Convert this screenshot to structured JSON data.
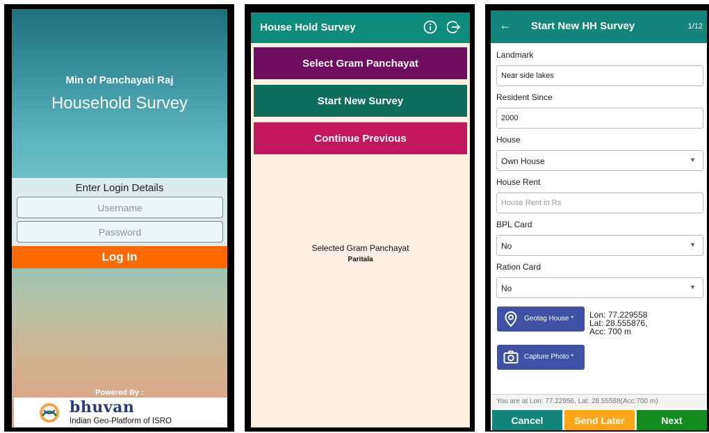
{
  "login_screen": {
    "org_name": "Min of Panchayati Raj",
    "app_name": "Household Survey",
    "login_header": "Enter Login Details",
    "username_placeholder": "Username",
    "password_placeholder": "Password",
    "login_button": "Log In",
    "powered_by": "Powered By :",
    "logo_name": "bhuvan",
    "logo_tagline": "Indian Geo-Platform of ISRO",
    "accent_color": "#ff6a00"
  },
  "home_screen": {
    "title": "House Hold Survey",
    "icons": [
      "info-icon",
      "logout-icon"
    ],
    "buttons": {
      "select_gp": "Select Gram Panchayat",
      "start_new": "Start New Survey",
      "continue_prev": "Continue Previous"
    },
    "selected_label": "Selected Gram Panchayat",
    "selected_value": "Paritala",
    "colors": {
      "header": "#0f8b7b",
      "select_gp": "#6e0d5e",
      "start_new": "#0e6e5c",
      "continue_prev": "#c2185b",
      "background": "#fdefe2"
    }
  },
  "survey_screen": {
    "back_icon": "back-arrow-icon",
    "title": "Start New HH Survey",
    "page_indicator": "1/12",
    "fields": {
      "landmark": {
        "label": "Landmark",
        "value": "Near side lakes"
      },
      "resident_since": {
        "label": "Resident Since",
        "value": "2000"
      },
      "house": {
        "label": "House",
        "value": "Own House"
      },
      "house_rent": {
        "label": "House Rent",
        "placeholder": "House Rent in Rs"
      },
      "bpl_card": {
        "label": "BPL Card",
        "value": "No"
      },
      "ration_card": {
        "label": "Ration Card",
        "value": "No"
      }
    },
    "geotag_button": "Geotag House *",
    "capture_button": "Capture Photo *",
    "geotag": {
      "lon": "Lon: 77.229558",
      "lat": "Lat: 28.555876,",
      "acc": "Acc: 700 m"
    },
    "status_line": "You are at Lon: 77.22956, Lat: 28.55588(Acc:700 m)",
    "footer": {
      "cancel": "Cancel",
      "send_later": "Send Later",
      "next": "Next"
    },
    "colors": {
      "header": "#13857a",
      "action_button": "#3f51a5",
      "cancel": "#13857a",
      "send_later": "#ffa51a",
      "next": "#128a1e"
    }
  }
}
